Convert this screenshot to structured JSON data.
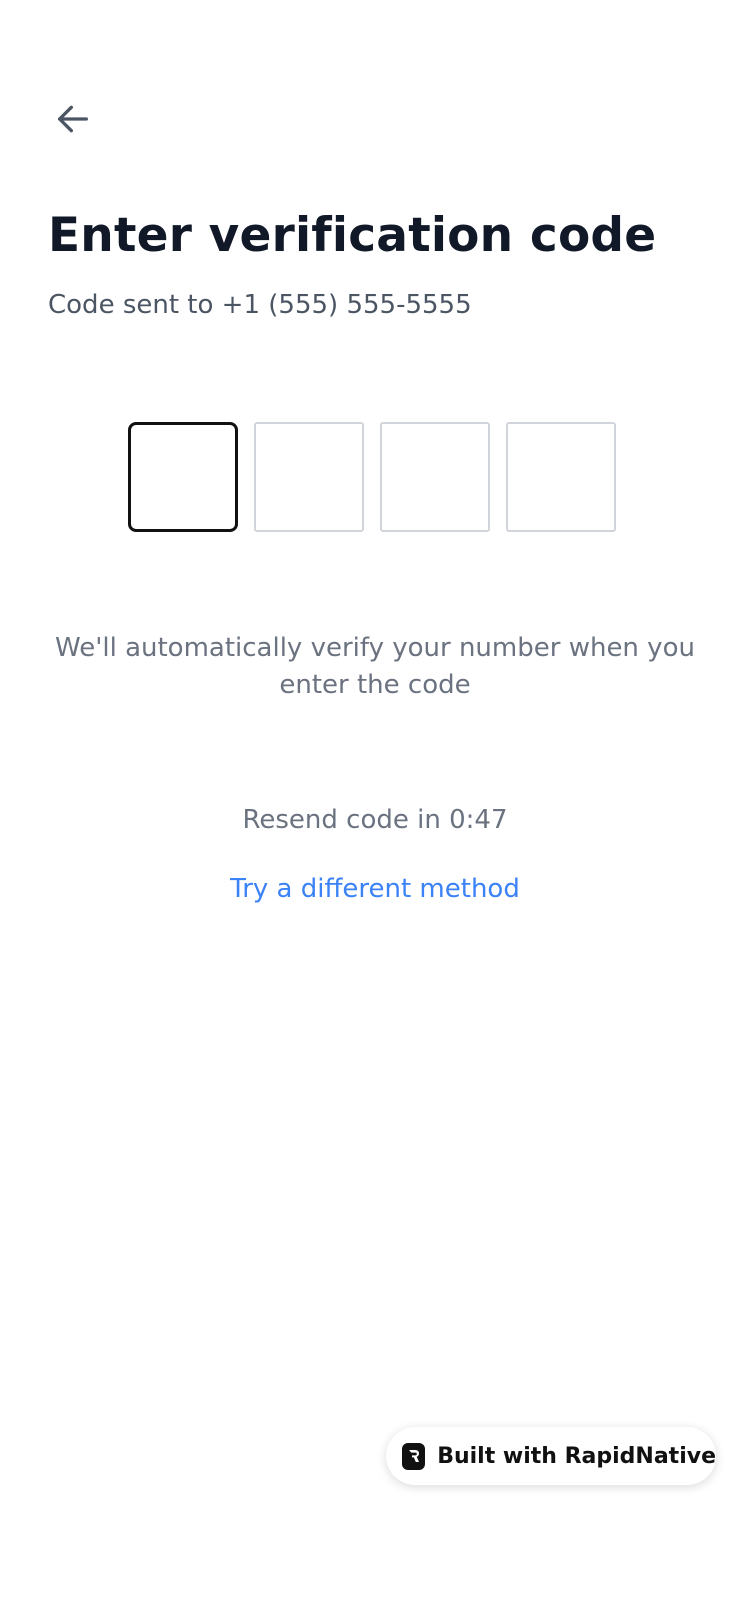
{
  "header": {
    "back_icon": "arrow-left-icon"
  },
  "content": {
    "title": "Enter verification code",
    "subtitle": "Code sent to +1 (555) 555-5555",
    "code_digits": [
      "",
      "",
      "",
      ""
    ],
    "info_line1": "We'll automatically verify your number when you",
    "info_line2": "enter the code",
    "resend_text": "Resend code in 0:47",
    "alt_method_label": "Try a different method"
  },
  "badge": {
    "label": "Built with RapidNative",
    "logo_icon": "rapidnative-logo-icon"
  },
  "colors": {
    "title": "#111827",
    "muted": "#6b7280",
    "link": "#3b82f6",
    "box_border": "#d1d5db",
    "box_active_border": "#111111"
  }
}
